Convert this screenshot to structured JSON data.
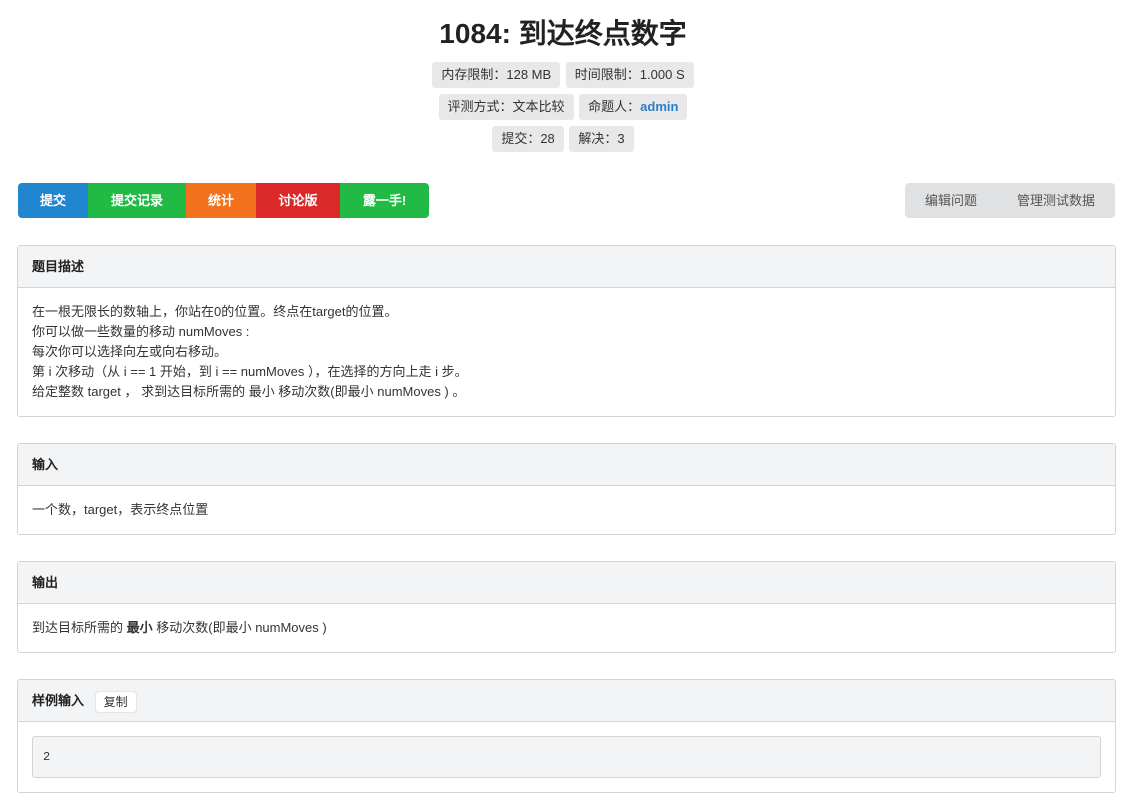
{
  "problem": {
    "title": "1084: 到达终点数字"
  },
  "meta": {
    "memory_limit": "内存限制：128 MB",
    "time_limit": "时间限制：1.000 S",
    "judge_mode": "评测方式：文本比较",
    "author_label": "命题人：",
    "author_name": "admin",
    "submissions": "提交：28",
    "solved": "解决：3"
  },
  "actions": {
    "submit": "提交",
    "records": "提交记录",
    "stats": "统计",
    "forum": "讨论版",
    "show_off": "露一手!"
  },
  "admin_actions": {
    "edit": "编辑问题",
    "manage_data": "管理测试数据"
  },
  "description": {
    "heading": "题目描述",
    "lines": [
      "在一根无限长的数轴上，你站在0的位置。终点在target的位置。",
      "你可以做一些数量的移动 numMoves :",
      "每次你可以选择向左或向右移动。",
      "第 i 次移动（从  i == 1 开始，到 i == numMoves ），在选择的方向上走 i 步。",
      "给定整数 target ， 求到达目标所需的 最小 移动次数(即最小 numMoves ) 。"
    ]
  },
  "input": {
    "heading": "输入",
    "text": "一个数，target，表示终点位置"
  },
  "output": {
    "heading": "输出",
    "prefix": "到达目标所需的 ",
    "bold": "最小",
    "suffix": " 移动次数(即最小 numMoves )"
  },
  "sample_input": {
    "heading": "样例输入",
    "copy_label": "复制",
    "value": "2"
  }
}
